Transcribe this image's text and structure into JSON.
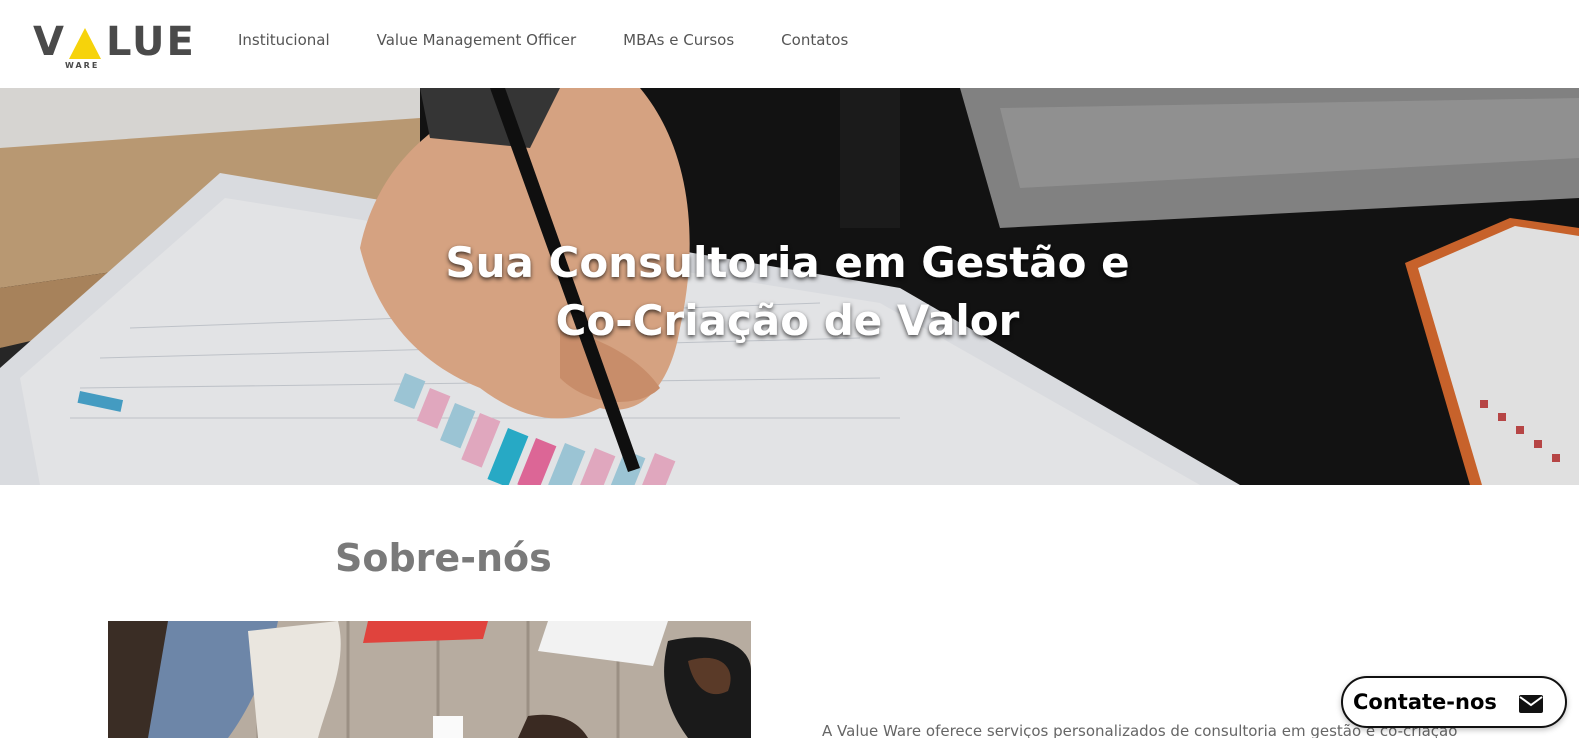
{
  "brand": {
    "letters_left": "V",
    "letters_right": "LUE",
    "sub": "WARE",
    "accent_color": "#f6d30b",
    "text_color": "#4a4a4a"
  },
  "nav": {
    "items": [
      {
        "label": "Institucional"
      },
      {
        "label": "Value Management Officer"
      },
      {
        "label": "MBAs e Cursos"
      },
      {
        "label": "Contatos"
      }
    ]
  },
  "hero": {
    "title_line1": "Sua Consultoria em Gestão e",
    "title_line2": "Co-Criação de Valor"
  },
  "about": {
    "title": "Sobre-nós",
    "text": "A Value Ware oferece serviços personalizados de consultoria em gestão e co-criação de"
  },
  "contact": {
    "label": "Contate-nos",
    "icon": "envelope-icon"
  }
}
